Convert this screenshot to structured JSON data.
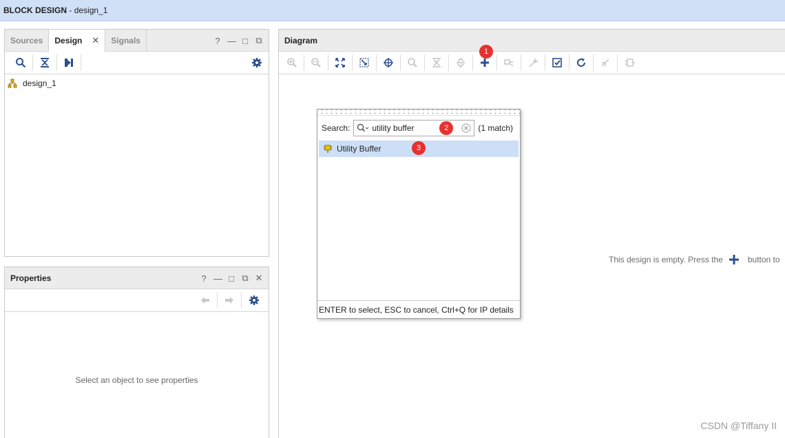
{
  "title": {
    "prefix": "BLOCK DESIGN",
    "separator": " - ",
    "name": "design_1"
  },
  "left_panel": {
    "tabs": [
      {
        "label": "Sources"
      },
      {
        "label": "Design"
      },
      {
        "label": "Signals"
      }
    ],
    "close_glyph": "✕",
    "controls": [
      "?",
      "—",
      "□",
      "⧉"
    ],
    "tree": [
      {
        "label": "design_1",
        "icon": "hierarchy-icon"
      }
    ]
  },
  "properties_panel": {
    "title": "Properties",
    "controls": [
      "?",
      "—",
      "□",
      "⧉",
      "✕"
    ],
    "empty_message": "Select an object to see properties"
  },
  "diagram_panel": {
    "title": "Diagram",
    "toolbar_icons": [
      "zoom-in-icon",
      "zoom-out-icon",
      "zoom-fit-icon",
      "zoom-area-icon",
      "center-icon",
      "search-icon",
      "collapse-all-icon",
      "expand-all-icon",
      "add-ip-icon",
      "make-connection-icon",
      "customize-icon",
      "validate-icon",
      "refresh-icon",
      "regenerate-layout-icon",
      "port-icon"
    ],
    "badges": {
      "add_ip": "1",
      "search": "2",
      "result": "3"
    },
    "empty_message_before": "This design is empty. Press the",
    "empty_message_after": "button to"
  },
  "ip_search_popup": {
    "search_label": "Search:",
    "search_value": "utility buffer",
    "match_count": "(1 match)",
    "results": [
      {
        "label": "Utility Buffer",
        "icon": "ip-core-icon"
      }
    ],
    "footer_hint": "ENTER to select, ESC to cancel, Ctrl+Q for IP details"
  },
  "watermark": "CSDN @Tiffany II",
  "colors": {
    "titlebar": "#cfe0f7",
    "selection": "#cddff7",
    "badge": "#e7312f",
    "accent": "#2b4f8c"
  }
}
